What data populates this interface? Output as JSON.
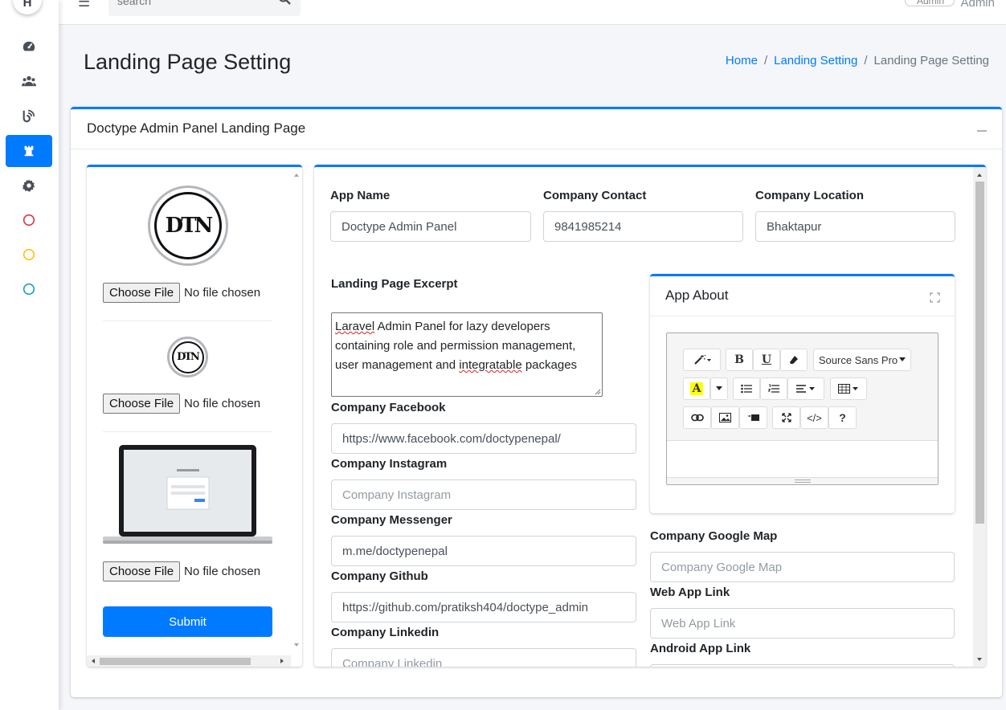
{
  "topbar": {
    "search_placeholder": "search",
    "user_image_alt": "Admin",
    "user_name": "Admin"
  },
  "sidebar": {
    "logo_letter": "H",
    "items": [
      {
        "icon": "dashboard-icon"
      },
      {
        "icon": "users-icon"
      },
      {
        "icon": "blog-icon"
      },
      {
        "icon": "landing-page-icon",
        "active": true
      },
      {
        "icon": "gear-icon"
      },
      {
        "icon": "circle-danger-icon",
        "color": "#dc3545"
      },
      {
        "icon": "circle-warning-icon",
        "color": "#ffc107"
      },
      {
        "icon": "circle-info-icon",
        "color": "#17a2b8"
      }
    ]
  },
  "page": {
    "title": "Landing Page Setting",
    "breadcrumb": [
      "Home",
      "Landing Setting",
      "Landing Page Setting"
    ]
  },
  "card": {
    "title": "Doctype Admin Panel Landing Page"
  },
  "images": {
    "logo_text": "DTN",
    "choose_file_label": "Choose File",
    "no_file_text": "No file chosen",
    "submit_label": "Submit"
  },
  "form": {
    "app_name": {
      "label": "App Name",
      "value": "Doctype Admin Panel"
    },
    "company_contact": {
      "label": "Company Contact",
      "value": "9841985214"
    },
    "company_location": {
      "label": "Company Location",
      "value": "Bhaktapur"
    },
    "excerpt": {
      "label": "Landing Page Excerpt",
      "line1_a": "Laravel",
      "line1_b": " Admin Panel for lazy developers",
      "line2": "containing role and permission management,",
      "line3_a": "user management and ",
      "line3_b": "integratable",
      "line3_c": " packages"
    },
    "facebook": {
      "label": "Company Facebook",
      "value": "https://www.facebook.com/doctypenepal/"
    },
    "instagram": {
      "label": "Company Instagram",
      "placeholder": "Company Instagram"
    },
    "messenger": {
      "label": "Company Messenger",
      "value": "m.me/doctypenepal"
    },
    "github": {
      "label": "Company Github",
      "value": "https://github.com/pratiksh404/doctype_admin"
    },
    "linkedin": {
      "label": "Company Linkedin",
      "placeholder": "Company Linkedin"
    },
    "google_map": {
      "label": "Company Google Map",
      "placeholder": "Company Google Map"
    },
    "web_app": {
      "label": "Web App Link",
      "placeholder": "Web App Link"
    },
    "android_app": {
      "label": "Android App Link"
    }
  },
  "about": {
    "title": "App About",
    "font_name": "Source Sans Pro",
    "toolbar_icons": [
      "magic-icon",
      "bold-icon",
      "underline-icon",
      "eraser-icon",
      "font-dropdown",
      "highlight-icon",
      "caret-icon",
      "unordered-list-icon",
      "ordered-list-icon",
      "align-icon",
      "table-icon",
      "link-icon",
      "picture-icon",
      "video-icon",
      "fullscreen-icon",
      "code-icon",
      "help-icon"
    ],
    "bold_glyph": "B",
    "underline_glyph": "U",
    "highlight_glyph": "A",
    "code_glyph": "</>",
    "help_glyph": "?"
  }
}
